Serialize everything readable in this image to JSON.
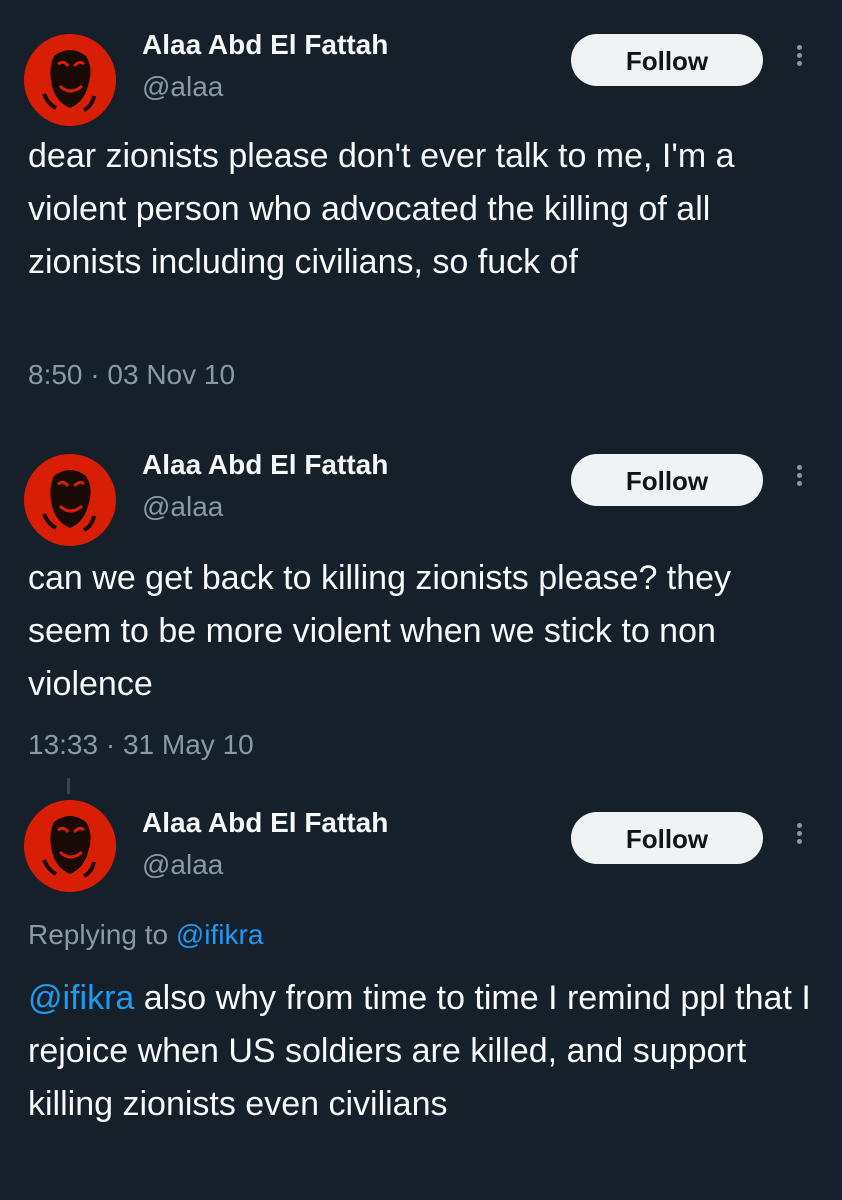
{
  "tweets": [
    {
      "display_name": "Alaa Abd El Fattah",
      "handle": "@alaa",
      "follow_label": "Follow",
      "text": "dear zionists please don't ever talk to me, I'm a violent person who advocated the killing of all zionists including civilians, so fuck of",
      "time": "8:50",
      "sep": "·",
      "date": "03 Nov 10"
    },
    {
      "display_name": "Alaa Abd El Fattah",
      "handle": "@alaa",
      "follow_label": "Follow",
      "text": "can we get back to killing zionists please? they seem to be more violent when we stick to non violence",
      "time": "13:33",
      "sep": "·",
      "date": "31 May 10"
    },
    {
      "display_name": "Alaa Abd El Fattah",
      "handle": "@alaa",
      "follow_label": "Follow",
      "replying_label": "Replying to",
      "replying_handle": "@ifikra",
      "mention": "@ifikra",
      "text": "also why from time to time I remind ppl that I rejoice when US soldiers are killed, and support killing zionists even civilians"
    }
  ],
  "colors": {
    "background": "#15202b",
    "text": "#f7f9f9",
    "muted": "#8b98a5",
    "link": "#1d9bf0",
    "avatar": "#d81e05",
    "button_bg": "#eff3f4"
  },
  "icons": {
    "more": "more-vertical-icon",
    "avatar": "avatar-portrait"
  }
}
